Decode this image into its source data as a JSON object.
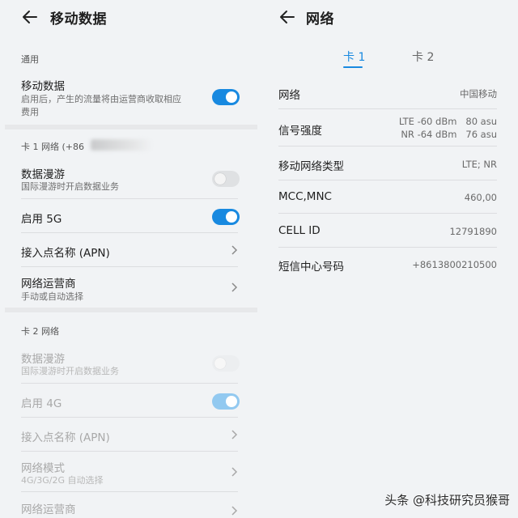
{
  "left": {
    "title": "移动数据",
    "general_label": "通用",
    "mobile_data": {
      "title": "移动数据",
      "sub1": "启用后，产生的流量将由运营商收取相应",
      "sub2": "费用",
      "toggle": "on"
    },
    "card1_label": "卡 1 网络 (+86",
    "card1": {
      "roaming": {
        "title": "数据漫游",
        "sub": "国际漫游时开启数据业务",
        "toggle": "off"
      },
      "enable5g": {
        "title": "启用 5G",
        "toggle": "on"
      },
      "apn": {
        "title": "接入点名称 (APN)"
      },
      "carrier": {
        "title": "网络运营商",
        "sub": "手动或自动选择"
      }
    },
    "card2_label": "卡 2 网络",
    "card2": {
      "roaming": {
        "title": "数据漫游",
        "sub": "国际漫游时开启数据业务",
        "toggle": "off-disabled"
      },
      "enable4g": {
        "title": "启用 4G",
        "toggle": "on-disabled"
      },
      "apn": {
        "title": "接入点名称 (APN)"
      },
      "mode": {
        "title": "网络模式",
        "sub": "4G/3G/2G 自动选择"
      },
      "carrier": {
        "title": "网络运营商"
      }
    }
  },
  "right": {
    "title": "网络",
    "tabs": [
      {
        "label": "卡 1",
        "active": true
      },
      {
        "label": "卡 2",
        "active": false
      }
    ],
    "rows": {
      "network": {
        "label": "网络",
        "value": "中国移动"
      },
      "signal": {
        "label": "信号强度",
        "value1": "LTE -60 dBm   80 asu",
        "value2": "NR -64 dBm   76 asu"
      },
      "type": {
        "label": "移动网络类型",
        "value": "LTE; NR"
      },
      "mcc": {
        "label": "MCC,MNC",
        "value": "460,00"
      },
      "cell": {
        "label": "CELL ID",
        "value": "12791890"
      },
      "sms": {
        "label": "短信中心号码",
        "value": "+8613800210500"
      }
    }
  },
  "watermark": "头条 @科技研究员猴哥",
  "colors": {
    "accent": "#1889e0",
    "background": "#f1f3f5"
  }
}
